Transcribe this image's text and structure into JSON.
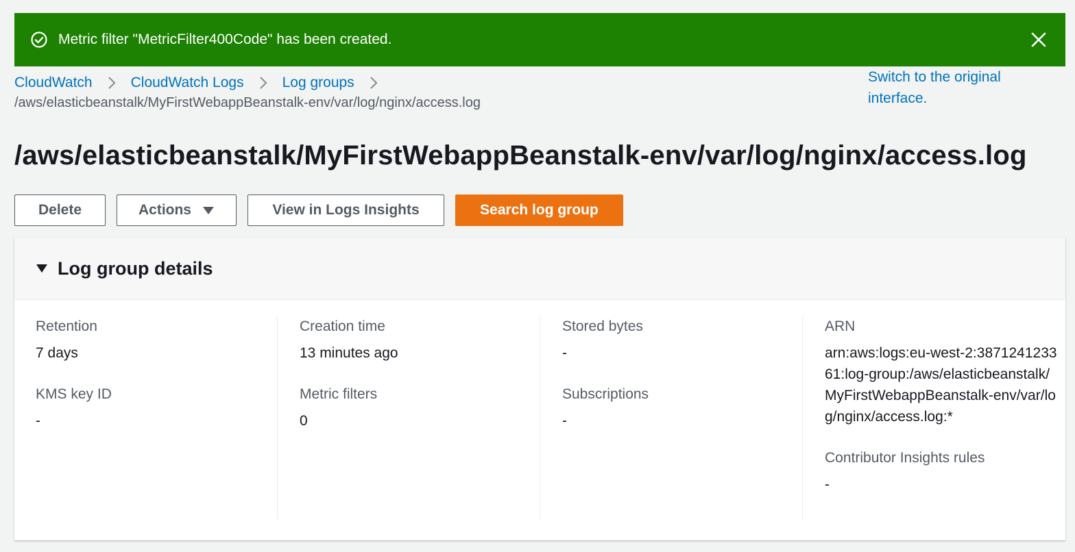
{
  "flash": {
    "message": "Metric filter \"MetricFilter400Code\" has been created."
  },
  "breadcrumb": {
    "items": [
      "CloudWatch",
      "CloudWatch Logs",
      "Log groups"
    ],
    "current": "/aws/elasticbeanstalk/MyFirstWebappBeanstalk-env/var/log/nginx/access.log"
  },
  "switch_link": "Switch to the original interface.",
  "page_title": "/aws/elasticbeanstalk/MyFirstWebappBeanstalk-env/var/log/nginx/access.log",
  "toolbar": {
    "delete": "Delete",
    "actions": "Actions",
    "insights": "View in Logs Insights",
    "search": "Search log group"
  },
  "details": {
    "title": "Log group details",
    "retention_label": "Retention",
    "retention_value": "7 days",
    "kms_label": "KMS key ID",
    "kms_value": "-",
    "creation_label": "Creation time",
    "creation_value": "13 minutes ago",
    "metric_label": "Metric filters",
    "metric_value": "0",
    "stored_label": "Stored bytes",
    "stored_value": "-",
    "subs_label": "Subscriptions",
    "subs_value": "-",
    "arn_label": "ARN",
    "arn_value": "arn:aws:logs:eu-west-2:387124123361:log-group:/aws/elasticbeanstalk/MyFirstWebappBeanstalk-env/var/log/nginx/access.log:*",
    "contrib_label": "Contributor Insights rules",
    "contrib_value": "-"
  },
  "colors": {
    "success": "#1d8102",
    "link": "#0073bb",
    "primary": "#ec7211"
  },
  "icons": [
    "check-circle-icon",
    "close-icon",
    "chevron-right-icon",
    "caret-down-icon",
    "triangle-down-icon"
  ]
}
